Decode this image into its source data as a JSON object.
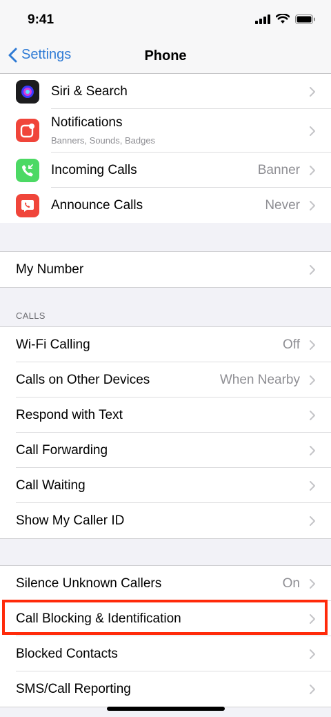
{
  "status": {
    "time": "9:41"
  },
  "nav": {
    "back_label": "Settings",
    "title": "Phone"
  },
  "colors": {
    "accent": "#2f7bd5",
    "highlight": "#ff2a0a"
  },
  "group1": {
    "items": [
      {
        "label": "Siri & Search",
        "icon": "siri-icon"
      },
      {
        "label": "Notifications",
        "subtitle": "Banners, Sounds, Badges",
        "icon": "notifications-icon"
      },
      {
        "label": "Incoming Calls",
        "value": "Banner",
        "icon": "incoming-calls-icon"
      },
      {
        "label": "Announce Calls",
        "value": "Never",
        "icon": "announce-calls-icon"
      }
    ]
  },
  "group2": {
    "items": [
      {
        "label": "My Number"
      }
    ]
  },
  "calls": {
    "header": "CALLS",
    "items": [
      {
        "label": "Wi-Fi Calling",
        "value": "Off"
      },
      {
        "label": "Calls on Other Devices",
        "value": "When Nearby"
      },
      {
        "label": "Respond with Text"
      },
      {
        "label": "Call Forwarding"
      },
      {
        "label": "Call Waiting"
      },
      {
        "label": "Show My Caller ID"
      }
    ]
  },
  "group4": {
    "items": [
      {
        "label": "Silence Unknown Callers",
        "value": "On"
      },
      {
        "label": "Call Blocking & Identification"
      },
      {
        "label": "Blocked Contacts"
      },
      {
        "label": "SMS/Call Reporting"
      }
    ]
  }
}
